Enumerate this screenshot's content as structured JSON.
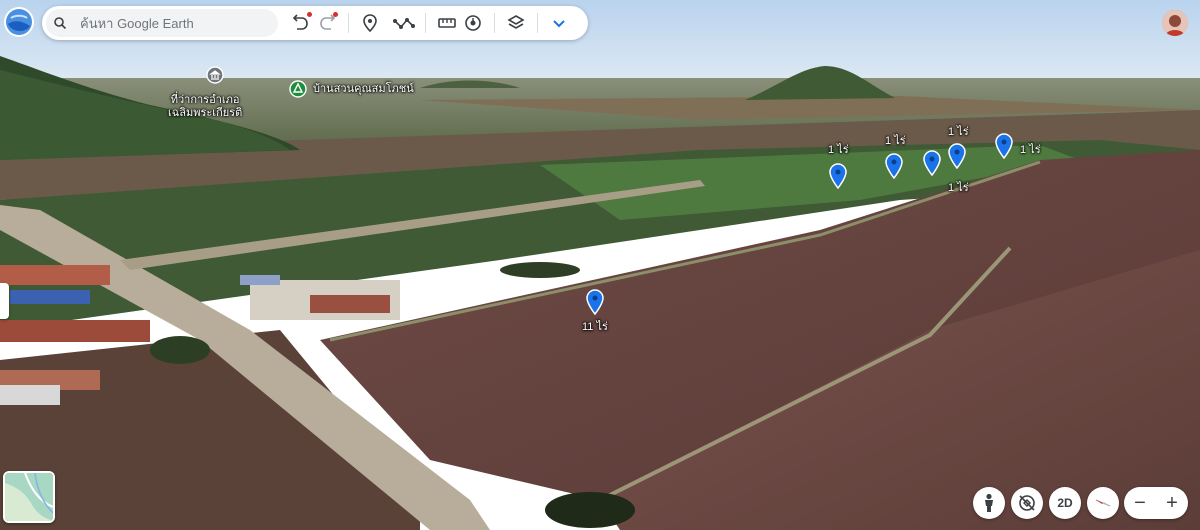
{
  "search": {
    "placeholder": "ค้นหา Google Earth"
  },
  "toolbar": {
    "undo_icon": "undo-icon",
    "redo_icon": "redo-icon",
    "placemark_icon": "placemark-icon",
    "path_icon": "path-icon",
    "measure_icon": "ruler-icon",
    "history_icon": "historical-imagery-icon",
    "layers_icon": "layers-icon",
    "more_icon": "chevron-down-icon"
  },
  "places": [
    {
      "name": "ที่ว่าการอำเภอ\nเฉลิมพระเกียรติ",
      "icon": "government-building-icon"
    },
    {
      "name": "บ้านสวนคุณสมโภชน์",
      "icon": "park-icon"
    }
  ],
  "placemarks": [
    {
      "label": "1 ไร่"
    },
    {
      "label": "1 ไร่"
    },
    {
      "label": "1 ไร่"
    },
    {
      "label": "1 ไร่"
    },
    {
      "label": "1 ไร่"
    },
    {
      "label": "11 ไร่"
    }
  ],
  "controls": {
    "street_view_icon": "pegman-icon",
    "tilt_icon": "tilt-reset-icon",
    "view_mode_label": "2D",
    "compass_icon": "compass-icon",
    "zoom_out_label": "−",
    "zoom_in_label": "+"
  },
  "colors": {
    "pin": "#1a73e8",
    "poi_green": "#1e8e3e",
    "poi_gray": "#70757a"
  }
}
